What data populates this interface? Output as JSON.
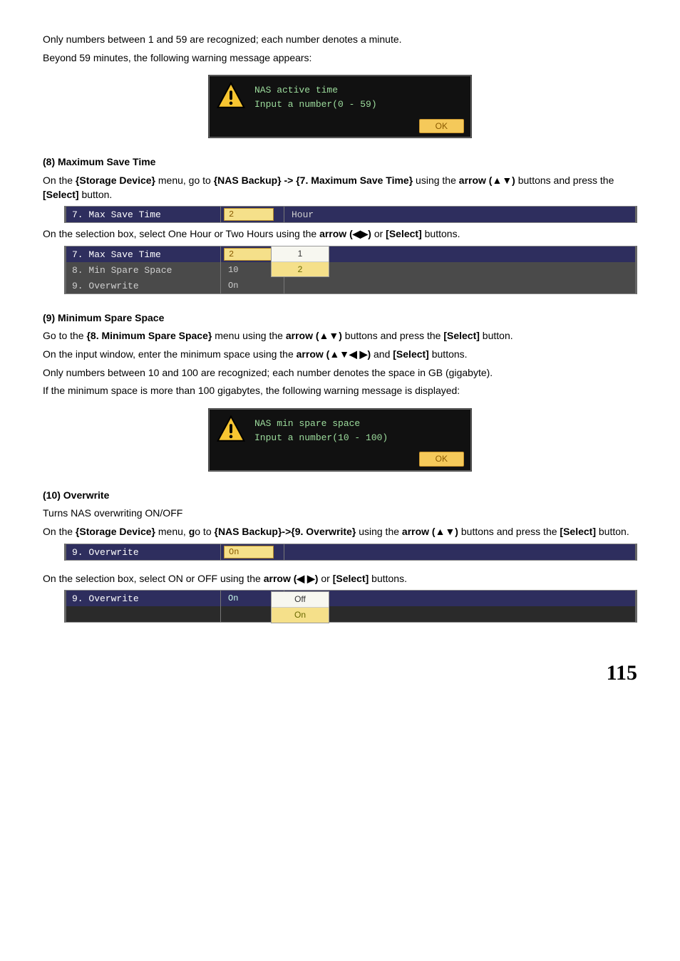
{
  "intro": {
    "line1": "Only numbers between 1 and 59 are recognized; each number denotes a minute.",
    "line2": "Beyond 59 minutes, the following warning message appears:"
  },
  "dialog1": {
    "title": "NAS active time",
    "body": "Input a number(0 - 59)",
    "ok": "OK"
  },
  "section8": {
    "heading": "(8) Maximum Save Time",
    "p1a": "On the ",
    "p1b": "{Storage Device}",
    "p1c": " menu, go to ",
    "p1d": "{NAS Backup} -> {7. Maximum Save Time}",
    "p1e": " using the ",
    "p1f": "arrow (▲▼)",
    "p1g": " buttons and press the ",
    "p1h": "[Select]",
    "p1i": " button.",
    "row_label": "7. Max Save Time",
    "row_val": "2",
    "row_unit": "Hour",
    "p2a": "On the selection box, select One Hour or Two Hours using the ",
    "p2b": "arrow (◀▶)",
    "p2c": " or ",
    "p2d": "[Select]",
    "p2e": " buttons.",
    "row2_label": "7. Max Save Time",
    "row2_val": "2",
    "row3_label": "8. Min Spare Space",
    "row3_val": "10",
    "row4_label": "9. Overwrite",
    "row4_val": "On",
    "dd_opt1": "1",
    "dd_opt2": "2"
  },
  "section9": {
    "heading": "(9) Minimum Spare Space",
    "p1a": "Go to the ",
    "p1b": "{8. Minimum Spare Space}",
    "p1c": " menu using the ",
    "p1d": "arrow (▲▼)",
    "p1e": " buttons and press the ",
    "p1f": "[Select]",
    "p1g": " button.",
    "p2a": "On the input window, enter the minimum space using the ",
    "p2b": "arrow (▲▼◀ ▶)",
    "p2c": " and ",
    "p2d": "[Select]",
    "p2e": " buttons.",
    "p3": "Only numbers between 10 and 100 are recognized; each number denotes the space in GB (gigabyte).",
    "p4": "If the minimum space is more than 100 gigabytes, the following warning message is displayed:"
  },
  "dialog2": {
    "title": "NAS min spare space",
    "body": "Input a number(10 - 100)",
    "ok": "OK"
  },
  "section10": {
    "heading": "(10) Overwrite",
    "sub": "Turns NAS overwriting ON/OFF",
    "p1a": "On the ",
    "p1b": "{Storage Device}",
    "p1c": " menu, ",
    "p1c2": "g",
    "p1d": "o to ",
    "p1e": "{NAS Backup}->{9. Overwrite}",
    "p1f": " using the ",
    "p1g": "arrow (▲▼)",
    "p1h": " buttons and press the ",
    "p1i": "[Select]",
    "p1j": " button.",
    "row_label": "9. Overwrite",
    "row_val": "On",
    "p2a": "On the selection box, select ON or OFF using the ",
    "p2b": "arrow (◀ ▶)",
    "p2c": " or ",
    "p2d": "[Select]",
    "p2e": " buttons.",
    "row2_label": "9. Overwrite",
    "row2_val": "On",
    "dd_opt1": "Off",
    "dd_opt2": "On"
  },
  "page_number": "115"
}
